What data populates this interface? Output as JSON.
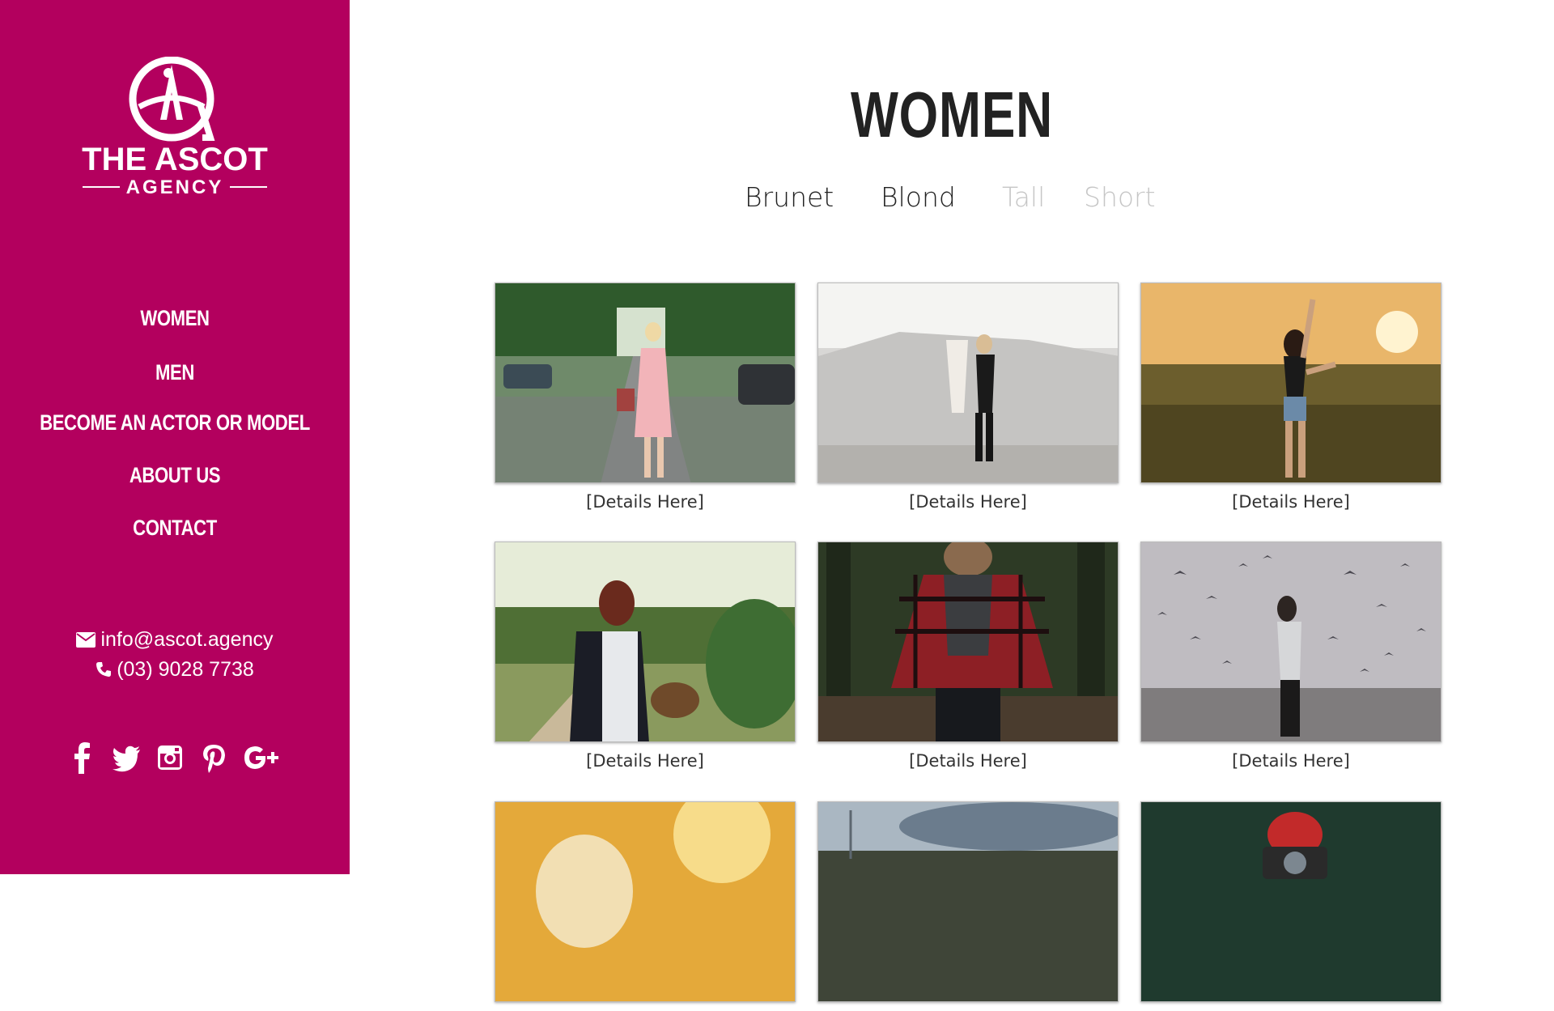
{
  "sidebar": {
    "logo": {
      "line1": "THE ASCOT",
      "line2": "AGENCY"
    },
    "nav": [
      "WOMEN",
      "MEN",
      "BECOME AN ACTOR OR MODEL",
      "ABOUT US",
      "CONTACT"
    ],
    "email": "info@ascot.agency",
    "phone": "(03) 9028 7738",
    "social": [
      "facebook-icon",
      "twitter-icon",
      "instagram-icon",
      "pinterest-icon",
      "google-plus-icon"
    ]
  },
  "main": {
    "title": "WOMEN",
    "filters": [
      {
        "label": "Brunet",
        "state": "active"
      },
      {
        "label": "Blond",
        "state": "active"
      },
      {
        "label": "Tall",
        "state": "inactive"
      },
      {
        "label": "Short",
        "state": "inactive"
      }
    ],
    "gallery": [
      {
        "caption": "[Details Here]"
      },
      {
        "caption": "[Details Here]"
      },
      {
        "caption": "[Details Here]"
      },
      {
        "caption": "[Details Here]"
      },
      {
        "caption": "[Details Here]"
      },
      {
        "caption": "[Details Here]"
      },
      {
        "caption": ""
      },
      {
        "caption": ""
      },
      {
        "caption": ""
      }
    ]
  },
  "colors": {
    "sidebar": "#b3005e",
    "text": "#222222",
    "inactive": "#c6c6c6"
  }
}
